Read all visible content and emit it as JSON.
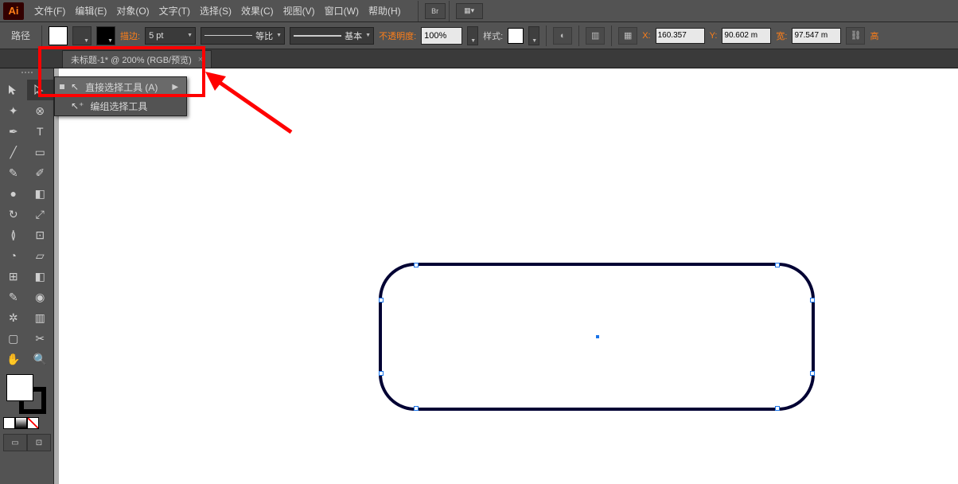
{
  "menu": {
    "file": "文件(F)",
    "edit": "编辑(E)",
    "object": "对象(O)",
    "type": "文字(T)",
    "select": "选择(S)",
    "effect": "效果(C)",
    "view": "视图(V)",
    "window": "窗口(W)",
    "help": "帮助(H)",
    "br": "Br"
  },
  "options": {
    "label_path": "路径",
    "stroke_label": "描边:",
    "stroke_val": "5 pt",
    "dash": "等比",
    "profile": "基本",
    "opacity_label": "不透明度:",
    "opacity_val": "100%",
    "style_label": "样式:",
    "x_label": "X:",
    "x_val": "160.357",
    "y_label": "Y:",
    "y_val": "90.602 m",
    "w_label": "宽:",
    "w_val": "97.547 m",
    "h_label": "高"
  },
  "tab": {
    "title": "未标题-1* @ 200% (RGB/预览)",
    "close": "×"
  },
  "flyout": {
    "direct": "直接选择工具 (A)",
    "group": "编组选择工具"
  }
}
